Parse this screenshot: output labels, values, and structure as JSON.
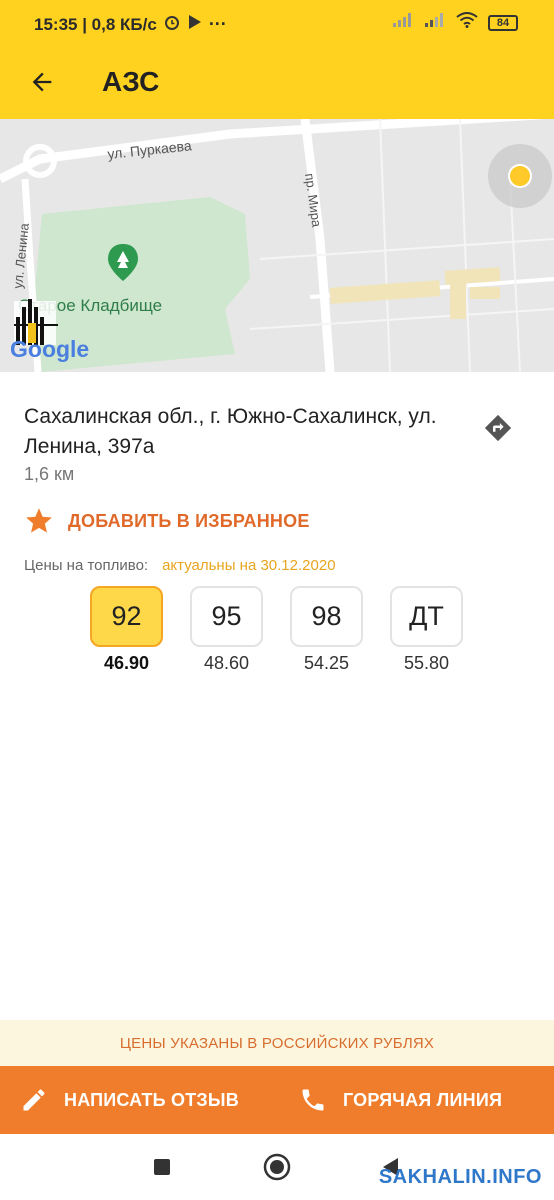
{
  "status": {
    "time_speed": "15:35 | 0,8 КБ/с",
    "battery": "84"
  },
  "appbar": {
    "title": "АЗС"
  },
  "map": {
    "labels": {
      "street_purkaeva": "ул. Пуркаева",
      "street_mira": "пр. Мира",
      "street_lenina": "ул. Ленина",
      "poi": "Старое Кладбище",
      "google": "Google"
    }
  },
  "station": {
    "address": "Сахалинская обл., г. Южно-Сахалинск, ул. Ленина, 397а",
    "distance": "1,6  км",
    "favorite_label": "ДОБАВИТЬ В ИЗБРАННОЕ",
    "prices_label": "Цены на топливо:",
    "prices_updated": "актуальны на 30.12.2020",
    "fuels": [
      {
        "grade": "92",
        "price": "46.90",
        "selected": true
      },
      {
        "grade": "95",
        "price": "48.60",
        "selected": false
      },
      {
        "grade": "98",
        "price": "54.25",
        "selected": false
      },
      {
        "grade": "ДТ",
        "price": "55.80",
        "selected": false
      }
    ]
  },
  "notice": "ЦЕНЫ УКАЗАНЫ В РОССИЙСКИХ РУБЛЯХ",
  "actions": {
    "review": "НАПИСАТЬ ОТЗЫВ",
    "hotline": "ГОРЯЧАЯ ЛИНИЯ"
  },
  "watermark": "SAKHALIN.INFO",
  "colors": {
    "brand_yellow": "#ffd21f",
    "accent_orange": "#f07d2b",
    "selected_fuel": "#ffd84a"
  }
}
